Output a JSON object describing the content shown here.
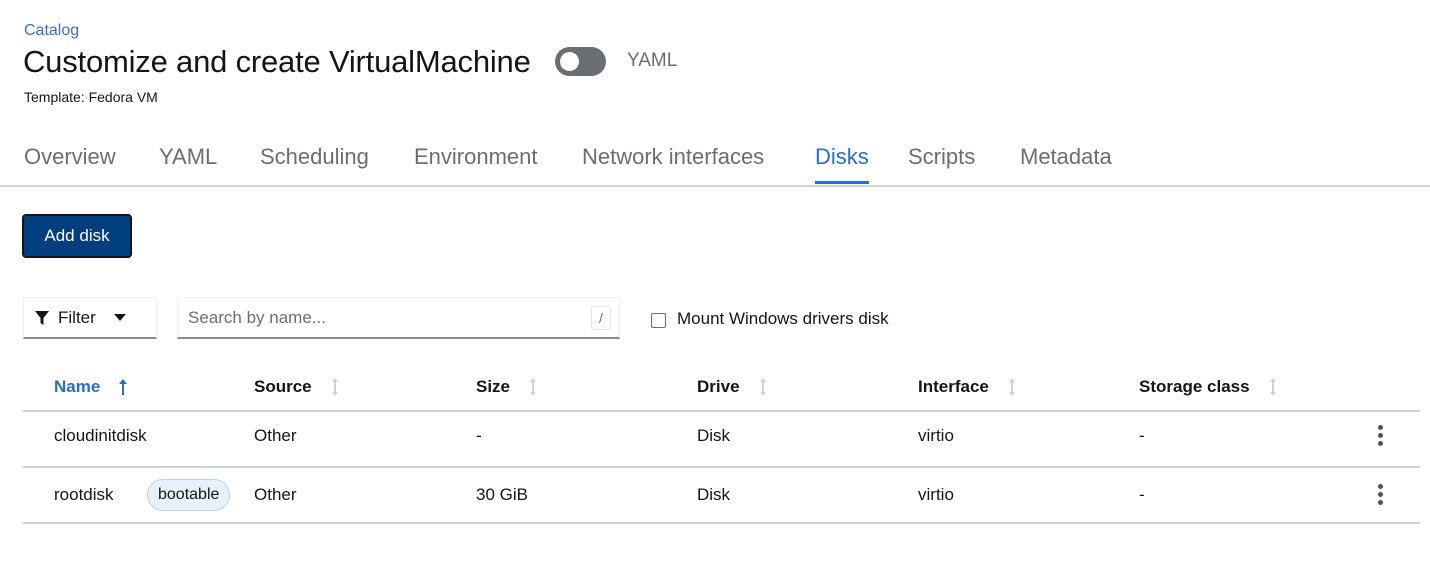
{
  "breadcrumb": {
    "items": [
      "Catalog"
    ]
  },
  "header": {
    "title": "Customize and create VirtualMachine",
    "yaml_toggle": {
      "label": "YAML",
      "checked": false
    },
    "subtitle": "Template: Fedora VM"
  },
  "tabs": [
    {
      "label": "Overview",
      "active": false
    },
    {
      "label": "YAML",
      "active": false
    },
    {
      "label": "Scheduling",
      "active": false
    },
    {
      "label": "Environment",
      "active": false
    },
    {
      "label": "Network interfaces",
      "active": false
    },
    {
      "label": "Disks",
      "active": true
    },
    {
      "label": "Scripts",
      "active": false
    },
    {
      "label": "Metadata",
      "active": false
    }
  ],
  "toolbar": {
    "add_disk_label": "Add disk",
    "filter_label": "Filter",
    "search_placeholder": "Search by name...",
    "search_value": "",
    "search_shortcut": "/",
    "mount_windows_drivers": {
      "label": "Mount Windows drivers disk",
      "checked": false
    }
  },
  "colors": {
    "accent": "#2b6dc4",
    "primary_button": "#003e7e",
    "label_bg": "#e7f1fa"
  },
  "table": {
    "columns": [
      {
        "label": "Name",
        "sort": "ascending"
      },
      {
        "label": "Source",
        "sort": "none"
      },
      {
        "label": "Size",
        "sort": "none"
      },
      {
        "label": "Drive",
        "sort": "none"
      },
      {
        "label": "Interface",
        "sort": "none"
      },
      {
        "label": "Storage class",
        "sort": "none"
      }
    ],
    "rows": [
      {
        "name": "cloudinitdisk",
        "badge": null,
        "source": "Other",
        "size": "-",
        "drive": "Disk",
        "interface": "virtio",
        "storage_class": "-"
      },
      {
        "name": "rootdisk",
        "badge": "bootable",
        "source": "Other",
        "size": "30 GiB",
        "drive": "Disk",
        "interface": "virtio",
        "storage_class": "-"
      }
    ]
  }
}
